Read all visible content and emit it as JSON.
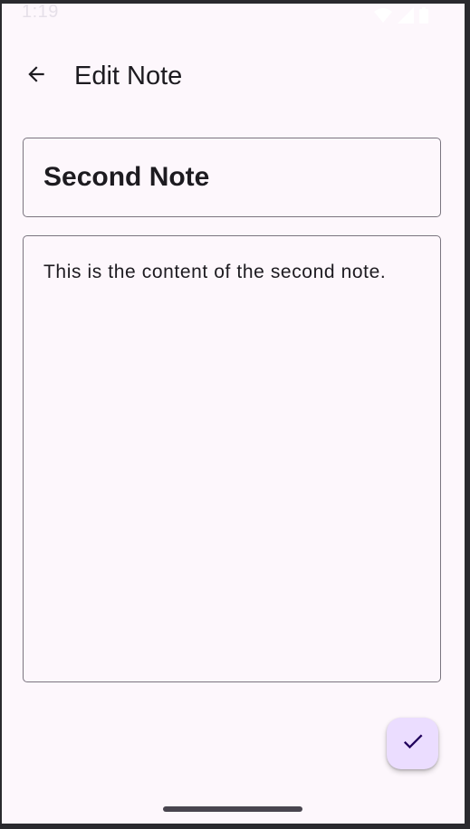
{
  "status_bar": {
    "time": "1:19",
    "icons": [
      "wifi-icon",
      "cellular-signal-icon",
      "battery-icon"
    ]
  },
  "app_bar": {
    "title": "Edit Note",
    "back_icon": "arrow-back-icon"
  },
  "note": {
    "title": "Second Note",
    "content": "This is the content of the second note."
  },
  "fab": {
    "icon": "check-icon",
    "color": "#ebddff"
  },
  "colors": {
    "background": "#fdf7fc",
    "text": "#1d1b20",
    "outline": "#7a757f"
  }
}
